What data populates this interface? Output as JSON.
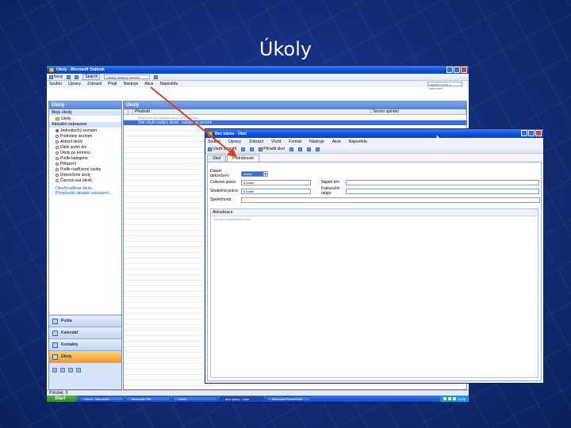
{
  "slide": {
    "title": "Úkoly"
  },
  "window": {
    "title": "Úkoly - Microsoft Outlook",
    "menu": [
      "Soubor",
      "Úpravy",
      "Zobrazit",
      "Přejít",
      "Nástroje",
      "Akce",
      "Nápověda"
    ],
    "toolbar": {
      "new_label": "Nový",
      "search_label": "Search",
      "address_placeholder": "Zadejte hledaný kontakt",
      "help_placeholder": "Napište dotaz k nápovědě"
    }
  },
  "nav": {
    "header": "Úkoly",
    "section_my": "Moje úkoly",
    "my_items": [
      "Úkoly"
    ],
    "section_view": "Aktuální zobrazení",
    "view_items": [
      "Jednoduchý seznam",
      "Podrobný seznam",
      "Aktivní úkoly",
      "Další sedm dní",
      "Úkoly po termínu",
      "Podle kategorie",
      "Přiřazení",
      "Podle nadřízené osoby",
      "Dokončené úkoly",
      "Časová osa úkolů"
    ],
    "links": [
      "Otevřít sdílené úkoly...",
      "Přizpůsobit aktuální zobrazení..."
    ],
    "wunderbar": [
      "Pošta",
      "Kalendář",
      "Kontakty",
      "Úkoly"
    ]
  },
  "tasklist": {
    "header": "Úkoly",
    "columns": [
      "Předmět",
      "Termín splnění"
    ],
    "new_placeholder": "Klepnutím sem přidáte novou položku Úkol",
    "rows": [
      "Zde chybí nadpis úkolu, zadejte jej prosím"
    ]
  },
  "status": {
    "text": "Položek: 0"
  },
  "taskbar": {
    "start": "Start",
    "buttons": [
      "Inbox - Microsoft...",
      "Microsoft Offi...",
      "Úkoly",
      "Bez názvu - Úkol",
      "Microsoft PowerPoint"
    ],
    "clock": "14:02"
  },
  "dialog": {
    "title": "Bez názvu - Úkol",
    "menu": [
      "Soubor",
      "Úpravy",
      "Zobrazit",
      "Vložit",
      "Formát",
      "Nástroje",
      "Akce",
      "Nápověda"
    ],
    "toolbar": {
      "save_label": "Uložit a zavřít",
      "assign_label": "Přiřadit úkol"
    },
    "tabs": [
      "Úkol",
      "Podrobnosti"
    ],
    "fields": {
      "date_completed_label": "Datum dokončení:",
      "date_completed_value": "žádné",
      "total_work_label": "Celková práce:",
      "total_work_value": "0 hodin",
      "actual_work_label": "Skutečná práce:",
      "actual_work_value": "0 hodin",
      "mileage_label": "Najeté km:",
      "billing_label": "Fakturační údaje:",
      "companies_label": "Společnosti:",
      "notes_header": "Aktualizace",
      "notes_hint": "Vytvořit nepřidělenou kopii"
    }
  }
}
